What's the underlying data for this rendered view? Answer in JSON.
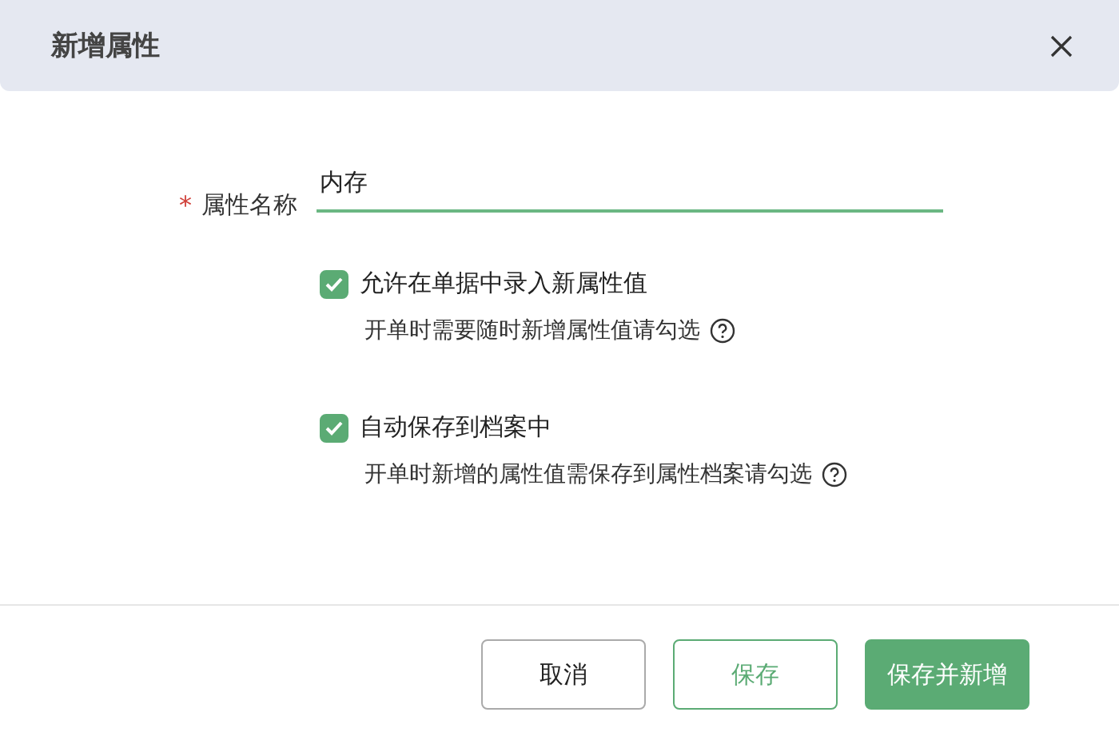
{
  "dialog": {
    "title": "新增属性"
  },
  "field": {
    "label": "属性名称",
    "required_mark": "*",
    "value": "内存"
  },
  "options": [
    {
      "label": "允许在单据中录入新属性值",
      "checked": true,
      "hint": "开单时需要随时新增属性值请勾选"
    },
    {
      "label": "自动保存到档案中",
      "checked": true,
      "hint": "开单时新增的属性值需保存到属性档案请勾选"
    }
  ],
  "buttons": [
    {
      "label": "取消",
      "kind": "default"
    },
    {
      "label": "保存",
      "kind": "outline"
    },
    {
      "label": "保存并新增",
      "kind": "primary"
    }
  ]
}
